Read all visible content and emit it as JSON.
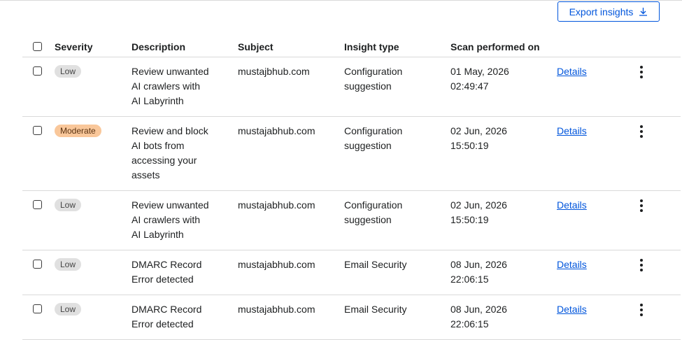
{
  "toolbar": {
    "export_label": "Export insights",
    "export_icon": "download-icon"
  },
  "table": {
    "headers": {
      "severity": "Severity",
      "description": "Description",
      "subject": "Subject",
      "insight_type": "Insight type",
      "scan": "Scan performed on"
    },
    "rows": [
      {
        "severity": "Low",
        "desc": [
          "Review unwanted",
          "AI crawlers with",
          "AI Labyrinth"
        ],
        "subject": "mustajbhub.com",
        "type": [
          "Configuration",
          "suggestion"
        ],
        "date": "01 May, 2026",
        "time": "02:49:47",
        "link": "Details"
      },
      {
        "severity": "Moderate",
        "desc": [
          "Review and block",
          "AI bots from",
          "accessing your",
          "assets"
        ],
        "subject": "mustajabhub.com",
        "type": [
          "Configuration",
          "suggestion"
        ],
        "date": "02 Jun, 2026",
        "time": "15:50:19",
        "link": "Details"
      },
      {
        "severity": "Low",
        "desc": [
          "Review unwanted",
          "AI crawlers with",
          "AI Labyrinth"
        ],
        "subject": "mustajabhub.com",
        "type": [
          "Configuration",
          "suggestion"
        ],
        "date": "02 Jun, 2026",
        "time": "15:50:19",
        "link": "Details"
      },
      {
        "severity": "Low",
        "desc": [
          "DMARC Record",
          "Error detected"
        ],
        "subject": "mustajabhub.com",
        "type": [
          "Email Security"
        ],
        "date": "08 Jun, 2026",
        "time": "22:06:15",
        "link": "Details"
      },
      {
        "severity": "Low",
        "desc": [
          "DMARC Record",
          "Error detected"
        ],
        "subject": "mustajabhub.com",
        "type": [
          "Email Security"
        ],
        "date": "08 Jun, 2026",
        "time": "22:06:15",
        "link": "Details"
      }
    ]
  }
}
